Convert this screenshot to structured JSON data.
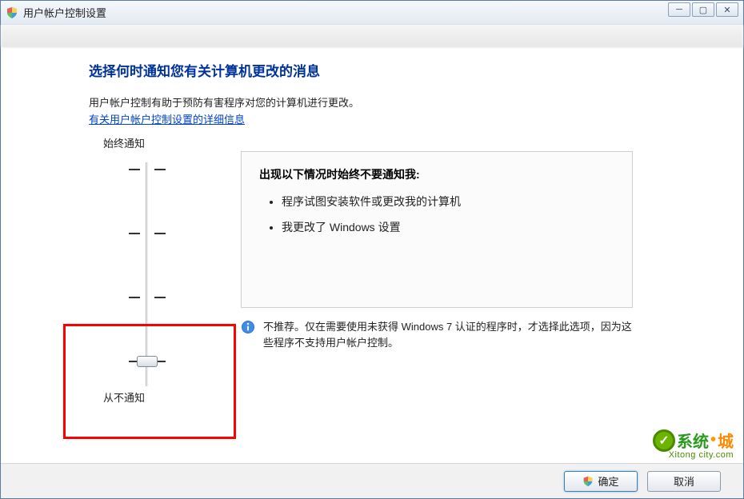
{
  "window": {
    "title": "用户帐户控制设置"
  },
  "page": {
    "heading": "选择何时通知您有关计算机更改的消息",
    "subtext": "用户帐户控制有助于预防有害程序对您的计算机进行更改。",
    "link": "有关用户帐户控制设置的详细信息"
  },
  "slider": {
    "top_label": "始终通知",
    "bottom_label": "从不通知",
    "position": 3,
    "steps": 4
  },
  "panel": {
    "title": "出现以下情况时始终不要通知我:",
    "items": [
      "程序试图安装软件或更改我的计算机",
      "我更改了 Windows 设置"
    ]
  },
  "recommendation": "不推荐。仅在需要使用未获得 Windows 7 认证的程序时，才选择此选项，因为这些程序不支持用户帐户控制。",
  "buttons": {
    "ok": "确定",
    "cancel": "取消"
  },
  "watermark": {
    "brand1": "系统",
    "brand2": "城",
    "url": "Xitong city.com"
  }
}
